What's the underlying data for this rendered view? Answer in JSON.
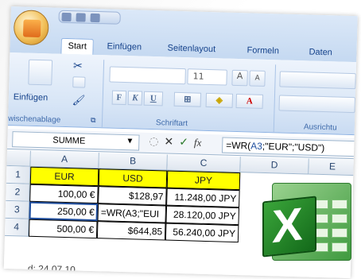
{
  "ribbon": {
    "tabs": [
      "Start",
      "Einfügen",
      "Seitenlayout",
      "Formeln",
      "Daten"
    ],
    "active_tab": "Start",
    "groups": {
      "clipboard": "Zwischenablage",
      "font": "Schriftart",
      "align": "Ausrichtu"
    },
    "paste_label": "Einfügen",
    "font_size": "11",
    "bold": "F",
    "italic": "K",
    "underline": "U"
  },
  "formula_bar": {
    "name_box": "SUMME",
    "formula_prefix": "=WR(",
    "formula_ref": "A3",
    "formula_suffix": ";\"EUR\";\"USD\")"
  },
  "grid": {
    "columns": [
      "A",
      "B",
      "C",
      "D",
      "E"
    ],
    "rows": [
      "1",
      "2",
      "3",
      "4"
    ],
    "headers": [
      "EUR",
      "USD",
      "JPY"
    ],
    "data": [
      [
        "100,00 €",
        "$128,97",
        "11.248,00 JPY"
      ],
      [
        "250,00 €",
        "=WR(A3;\"EUI",
        "28.120,00 JPY"
      ],
      [
        "500,00 €",
        "$644,85",
        "56.240,00 JPY"
      ]
    ]
  },
  "status_text": "d: 24.07.10",
  "colors": {
    "header_fill": "#ffff00",
    "excel_green": "#1e7a2a"
  }
}
